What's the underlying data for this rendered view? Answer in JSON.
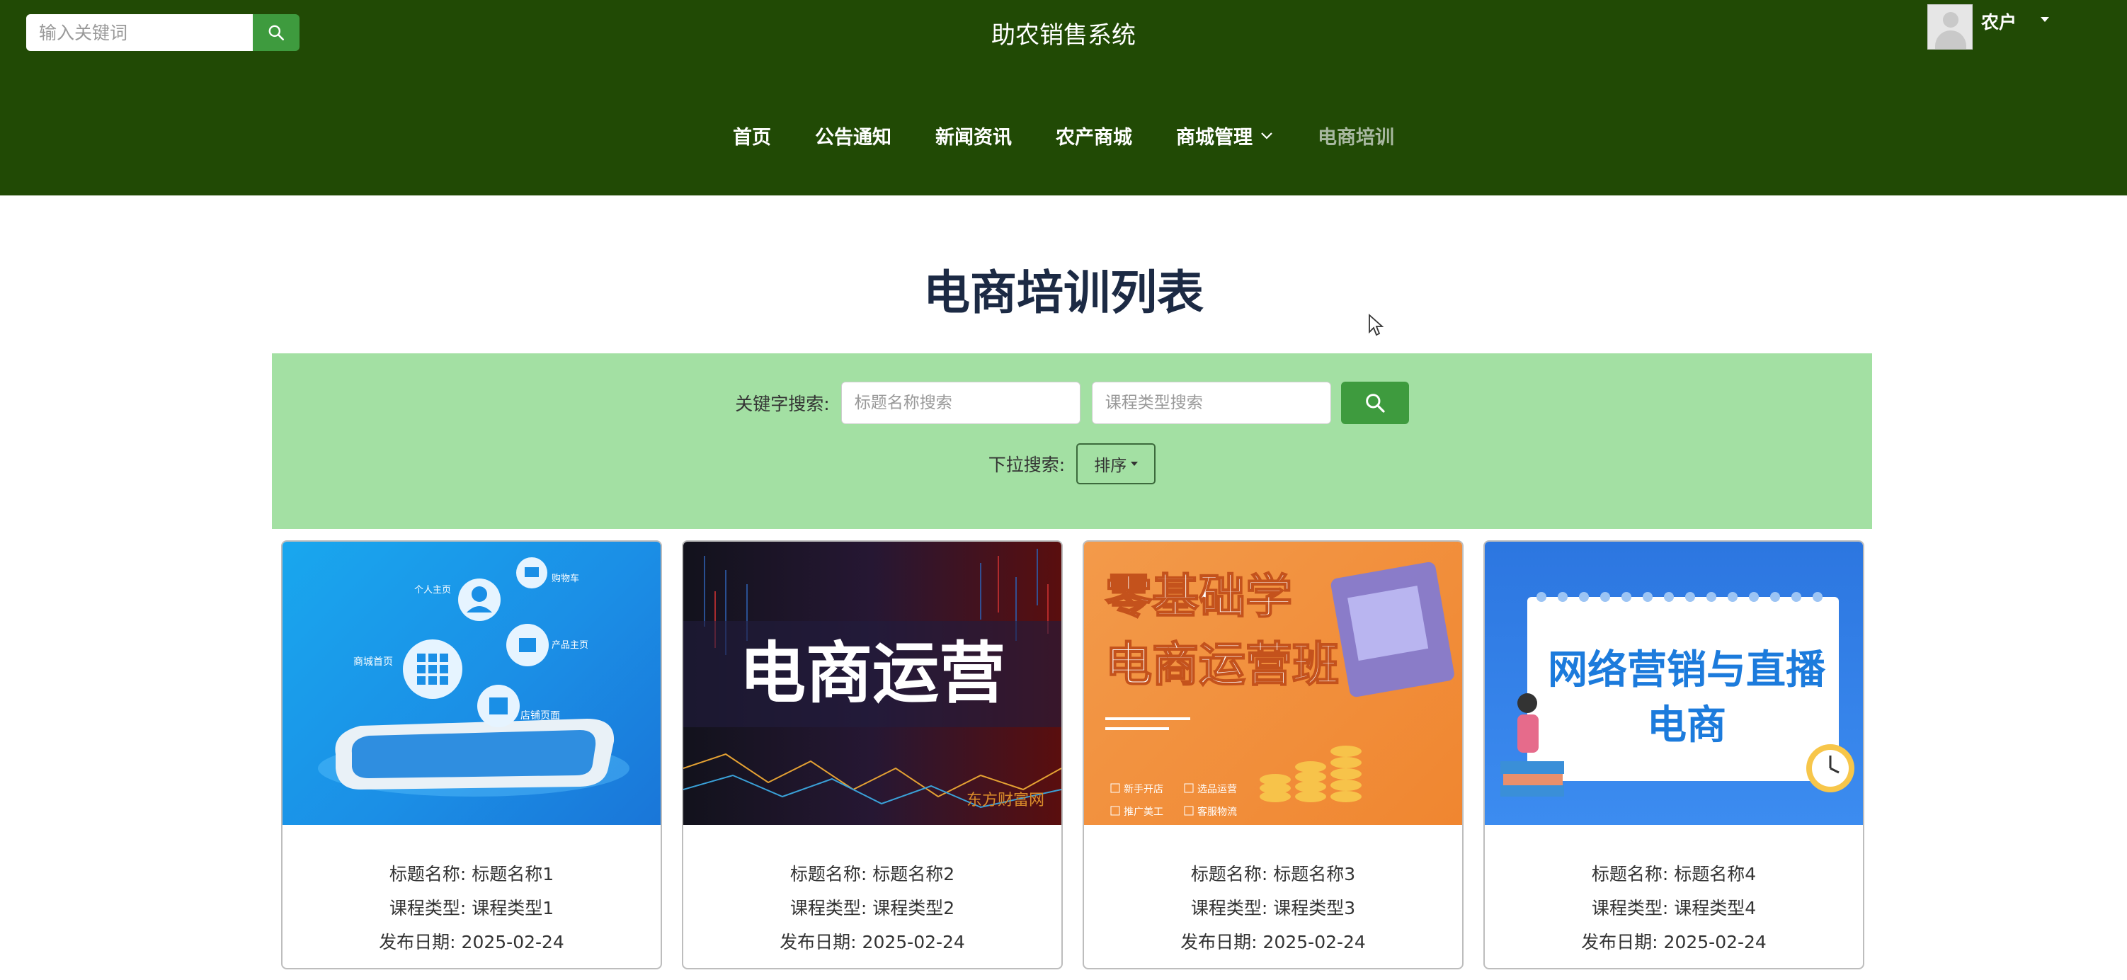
{
  "header": {
    "search_placeholder": "输入关键词",
    "site_title": "助农销售系统",
    "user_name": "农户"
  },
  "nav": {
    "items": [
      {
        "label": "首页"
      },
      {
        "label": "公告通知"
      },
      {
        "label": "新闻资讯"
      },
      {
        "label": "农产商城"
      },
      {
        "label": "商城管理"
      },
      {
        "label": "电商培训"
      }
    ]
  },
  "main": {
    "page_title": "电商培训列表",
    "filter": {
      "keyword_label": "关键字搜索:",
      "title_placeholder": "标题名称搜索",
      "type_placeholder": "课程类型搜索",
      "dropdown_label": "下拉搜索:",
      "sort_label": "排序"
    },
    "cards": [
      {
        "title_label": "标题名称:",
        "title": "标题名称1",
        "type_label": "课程类型:",
        "type": "课程类型1",
        "date_label": "发布日期:",
        "date": "2025-02-24",
        "image_texts": [
          "个人主页",
          "购物车",
          "商城首页",
          "产品主页",
          "店铺页面"
        ]
      },
      {
        "title_label": "标题名称:",
        "title": "标题名称2",
        "type_label": "课程类型:",
        "type": "课程类型2",
        "date_label": "发布日期:",
        "date": "2025-02-24",
        "image_texts": [
          "电商运营",
          "东方财富网"
        ]
      },
      {
        "title_label": "标题名称:",
        "title": "标题名称3",
        "type_label": "课程类型:",
        "type": "课程类型3",
        "date_label": "发布日期:",
        "date": "2025-02-24",
        "image_texts": [
          "零基础学",
          "电商运营班",
          "新手开店",
          "选品运营",
          "推广美工",
          "客服物流"
        ]
      },
      {
        "title_label": "标题名称:",
        "title": "标题名称4",
        "type_label": "课程类型:",
        "type": "课程类型4",
        "date_label": "发布日期:",
        "date": "2025-02-24",
        "image_texts": [
          "网络营销与直播",
          "电商"
        ]
      }
    ]
  },
  "colors": {
    "header_bg": "#214a05",
    "accent_green": "#3e9b3e",
    "filter_bg": "#a3e0a3",
    "title_color": "#1c2a44"
  }
}
